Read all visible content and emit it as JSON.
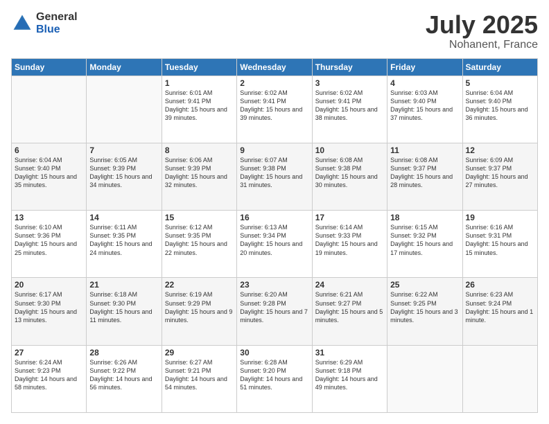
{
  "logo": {
    "general": "General",
    "blue": "Blue"
  },
  "title": {
    "month": "July 2025",
    "location": "Nohanent, France"
  },
  "header": {
    "days": [
      "Sunday",
      "Monday",
      "Tuesday",
      "Wednesday",
      "Thursday",
      "Friday",
      "Saturday"
    ]
  },
  "weeks": [
    [
      {
        "day": "",
        "info": ""
      },
      {
        "day": "",
        "info": ""
      },
      {
        "day": "1",
        "info": "Sunrise: 6:01 AM\nSunset: 9:41 PM\nDaylight: 15 hours and 39 minutes."
      },
      {
        "day": "2",
        "info": "Sunrise: 6:02 AM\nSunset: 9:41 PM\nDaylight: 15 hours and 39 minutes."
      },
      {
        "day": "3",
        "info": "Sunrise: 6:02 AM\nSunset: 9:41 PM\nDaylight: 15 hours and 38 minutes."
      },
      {
        "day": "4",
        "info": "Sunrise: 6:03 AM\nSunset: 9:40 PM\nDaylight: 15 hours and 37 minutes."
      },
      {
        "day": "5",
        "info": "Sunrise: 6:04 AM\nSunset: 9:40 PM\nDaylight: 15 hours and 36 minutes."
      }
    ],
    [
      {
        "day": "6",
        "info": "Sunrise: 6:04 AM\nSunset: 9:40 PM\nDaylight: 15 hours and 35 minutes."
      },
      {
        "day": "7",
        "info": "Sunrise: 6:05 AM\nSunset: 9:39 PM\nDaylight: 15 hours and 34 minutes."
      },
      {
        "day": "8",
        "info": "Sunrise: 6:06 AM\nSunset: 9:39 PM\nDaylight: 15 hours and 32 minutes."
      },
      {
        "day": "9",
        "info": "Sunrise: 6:07 AM\nSunset: 9:38 PM\nDaylight: 15 hours and 31 minutes."
      },
      {
        "day": "10",
        "info": "Sunrise: 6:08 AM\nSunset: 9:38 PM\nDaylight: 15 hours and 30 minutes."
      },
      {
        "day": "11",
        "info": "Sunrise: 6:08 AM\nSunset: 9:37 PM\nDaylight: 15 hours and 28 minutes."
      },
      {
        "day": "12",
        "info": "Sunrise: 6:09 AM\nSunset: 9:37 PM\nDaylight: 15 hours and 27 minutes."
      }
    ],
    [
      {
        "day": "13",
        "info": "Sunrise: 6:10 AM\nSunset: 9:36 PM\nDaylight: 15 hours and 25 minutes."
      },
      {
        "day": "14",
        "info": "Sunrise: 6:11 AM\nSunset: 9:35 PM\nDaylight: 15 hours and 24 minutes."
      },
      {
        "day": "15",
        "info": "Sunrise: 6:12 AM\nSunset: 9:35 PM\nDaylight: 15 hours and 22 minutes."
      },
      {
        "day": "16",
        "info": "Sunrise: 6:13 AM\nSunset: 9:34 PM\nDaylight: 15 hours and 20 minutes."
      },
      {
        "day": "17",
        "info": "Sunrise: 6:14 AM\nSunset: 9:33 PM\nDaylight: 15 hours and 19 minutes."
      },
      {
        "day": "18",
        "info": "Sunrise: 6:15 AM\nSunset: 9:32 PM\nDaylight: 15 hours and 17 minutes."
      },
      {
        "day": "19",
        "info": "Sunrise: 6:16 AM\nSunset: 9:31 PM\nDaylight: 15 hours and 15 minutes."
      }
    ],
    [
      {
        "day": "20",
        "info": "Sunrise: 6:17 AM\nSunset: 9:30 PM\nDaylight: 15 hours and 13 minutes."
      },
      {
        "day": "21",
        "info": "Sunrise: 6:18 AM\nSunset: 9:30 PM\nDaylight: 15 hours and 11 minutes."
      },
      {
        "day": "22",
        "info": "Sunrise: 6:19 AM\nSunset: 9:29 PM\nDaylight: 15 hours and 9 minutes."
      },
      {
        "day": "23",
        "info": "Sunrise: 6:20 AM\nSunset: 9:28 PM\nDaylight: 15 hours and 7 minutes."
      },
      {
        "day": "24",
        "info": "Sunrise: 6:21 AM\nSunset: 9:27 PM\nDaylight: 15 hours and 5 minutes."
      },
      {
        "day": "25",
        "info": "Sunrise: 6:22 AM\nSunset: 9:25 PM\nDaylight: 15 hours and 3 minutes."
      },
      {
        "day": "26",
        "info": "Sunrise: 6:23 AM\nSunset: 9:24 PM\nDaylight: 15 hours and 1 minute."
      }
    ],
    [
      {
        "day": "27",
        "info": "Sunrise: 6:24 AM\nSunset: 9:23 PM\nDaylight: 14 hours and 58 minutes."
      },
      {
        "day": "28",
        "info": "Sunrise: 6:26 AM\nSunset: 9:22 PM\nDaylight: 14 hours and 56 minutes."
      },
      {
        "day": "29",
        "info": "Sunrise: 6:27 AM\nSunset: 9:21 PM\nDaylight: 14 hours and 54 minutes."
      },
      {
        "day": "30",
        "info": "Sunrise: 6:28 AM\nSunset: 9:20 PM\nDaylight: 14 hours and 51 minutes."
      },
      {
        "day": "31",
        "info": "Sunrise: 6:29 AM\nSunset: 9:18 PM\nDaylight: 14 hours and 49 minutes."
      },
      {
        "day": "",
        "info": ""
      },
      {
        "day": "",
        "info": ""
      }
    ]
  ]
}
